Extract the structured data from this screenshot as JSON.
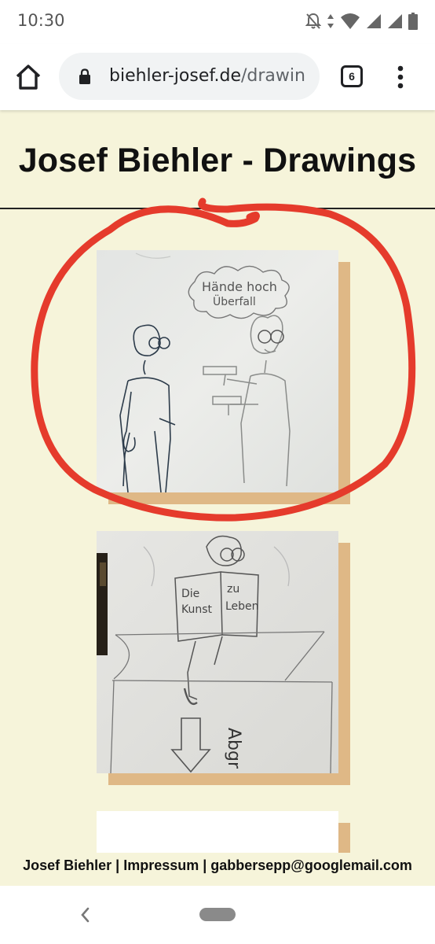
{
  "status_bar": {
    "time": "10:30",
    "icons": [
      "notifications-off-icon",
      "data-arrows-icon",
      "wifi-icon",
      "signal-icon",
      "signal-icon",
      "battery-icon"
    ]
  },
  "browser": {
    "url_domain": "biehler-josef.de",
    "url_path": "/drawin",
    "tab_count": "6",
    "icons": [
      "home-icon",
      "lock-icon",
      "tabs-icon",
      "menu-icon"
    ]
  },
  "page": {
    "title": "Josef Biehler - Drawings",
    "drawings": [
      {
        "speech": [
          "Hände hoch",
          "Überfall"
        ]
      },
      {
        "book_left": [
          "Die",
          "Kunst"
        ],
        "book_right": [
          "zu",
          "Leben"
        ],
        "sign": "Abgr"
      }
    ],
    "footer": "Josef Biehler | Impressum | gabbersepp@googlemail.com"
  },
  "colors": {
    "page_background": "#f6f4da",
    "card_shadow": "#dfb886",
    "annotation_circle": "#e53b2c"
  },
  "system_nav": {
    "icons": [
      "back-icon",
      "home-pill-icon"
    ]
  }
}
